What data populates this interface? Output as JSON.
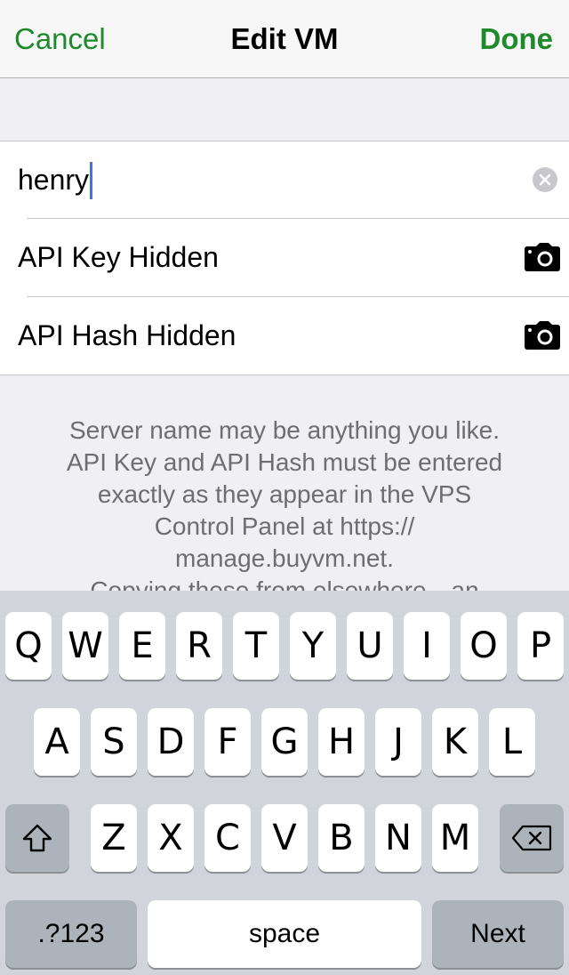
{
  "navbar": {
    "cancel_label": "Cancel",
    "title": "Edit VM",
    "done_label": "Done",
    "accent_color": "#1e8a2c"
  },
  "form": {
    "server_name_value": "henry",
    "clear_icon": "clear-circle-icon",
    "api_key_label": "API Key Hidden",
    "api_hash_label": "API Hash Hidden",
    "camera_icon": "camera-icon"
  },
  "footer": {
    "line1": "Server name may be anything you like.",
    "line2": "API Key and API Hash must be entered",
    "line3": "exactly as they appear in the VPS",
    "line4": "Control Panel at https://",
    "line5": "manage.buyvm.net.",
    "line6": "Copying these from elsewhere—an"
  },
  "keyboard": {
    "row1": [
      "Q",
      "W",
      "E",
      "R",
      "T",
      "Y",
      "U",
      "I",
      "O",
      "P"
    ],
    "row2": [
      "A",
      "S",
      "D",
      "F",
      "G",
      "H",
      "J",
      "K",
      "L"
    ],
    "row3": [
      "Z",
      "X",
      "C",
      "V",
      "B",
      "N",
      "M"
    ],
    "shift_icon": "shift-icon",
    "delete_icon": "backspace-icon",
    "numbers_label": ".?123",
    "space_label": "space",
    "next_label": "Next"
  }
}
